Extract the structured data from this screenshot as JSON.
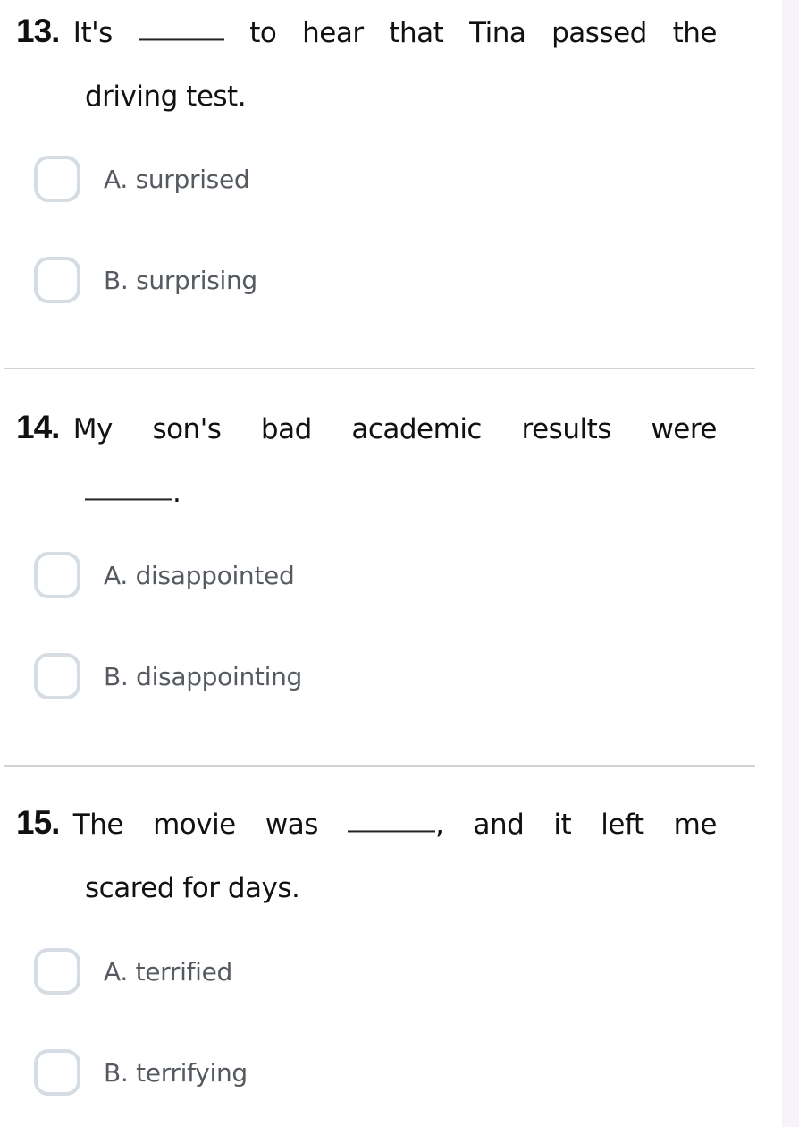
{
  "colors": {
    "question_text": "#111111",
    "option_text": "#555a61",
    "checkbox_border": "#d6dce3",
    "divider": "#d2d2d2",
    "gutter": "#f7f3fa"
  },
  "questions": [
    {
      "number": "13.",
      "line1": {
        "pre": "It's",
        "post_words": [
          "to",
          "hear",
          "that",
          "Tina",
          "passed",
          "the"
        ]
      },
      "line2": "driving test.",
      "options": [
        {
          "label": "A. surprised",
          "checked": false
        },
        {
          "label": "B. surprising",
          "checked": false
        }
      ]
    },
    {
      "number": "14.",
      "line1": {
        "words": [
          "My",
          "son's",
          "bad",
          "academic",
          "results",
          "were"
        ]
      },
      "line2_suffix": ".",
      "options": [
        {
          "label": "A. disappointed",
          "checked": false
        },
        {
          "label": "B. disappointing",
          "checked": false
        }
      ]
    },
    {
      "number": "15.",
      "line1": {
        "pre_words": [
          "The",
          "movie",
          "was"
        ],
        "blank_suffix": ",",
        "post_words": [
          "and",
          "it",
          "left",
          "me"
        ]
      },
      "line2": "scared for days.",
      "options": [
        {
          "label": "A. terrified",
          "checked": false
        },
        {
          "label": "B. terrifying",
          "checked": false
        }
      ]
    }
  ]
}
